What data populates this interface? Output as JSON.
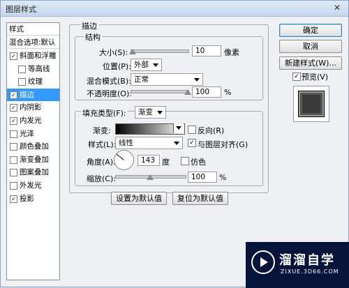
{
  "window": {
    "title": "图层样式",
    "close_glyph": "✕"
  },
  "styles_panel": {
    "header": "样式",
    "blend_options": "混合选项:默认",
    "items": [
      {
        "label": "斜面和浮雕",
        "checked": true,
        "sub": false
      },
      {
        "label": "等高线",
        "checked": false,
        "sub": true
      },
      {
        "label": "纹理",
        "checked": false,
        "sub": true
      },
      {
        "label": "描边",
        "checked": true,
        "sub": false,
        "selected": true
      },
      {
        "label": "内阴影",
        "checked": true,
        "sub": false
      },
      {
        "label": "内发光",
        "checked": true,
        "sub": false
      },
      {
        "label": "光泽",
        "checked": false,
        "sub": false
      },
      {
        "label": "颜色叠加",
        "checked": false,
        "sub": false
      },
      {
        "label": "渐变叠加",
        "checked": false,
        "sub": false
      },
      {
        "label": "图案叠加",
        "checked": false,
        "sub": false
      },
      {
        "label": "外发光",
        "checked": false,
        "sub": false
      },
      {
        "label": "投影",
        "checked": true,
        "sub": false
      }
    ]
  },
  "stroke": {
    "title": "描边",
    "structure": {
      "title": "结构",
      "size_label": "大小(S):",
      "size_value": "10",
      "size_unit": "像素",
      "position_label": "位置(P):",
      "position_value": "外部",
      "blend_label": "混合模式(B):",
      "blend_value": "正常",
      "opacity_label": "不透明度(O):",
      "opacity_value": "100",
      "opacity_unit": "%",
      "size_level": 0.04,
      "opacity_level": 1.0
    },
    "fill": {
      "type_label": "填充类型(F):",
      "type_value": "渐变",
      "gradient_label": "渐变:",
      "reverse_label": "反向(R)",
      "reverse_checked": false,
      "style_label": "样式(L):",
      "style_value": "线性",
      "align_label": "与图层对齐(G)",
      "align_checked": true,
      "angle_label": "角度(A):",
      "angle_value": "143",
      "angle_unit": "度",
      "dither_label": "仿色",
      "dither_checked": false,
      "scale_label": "缩放(C):",
      "scale_value": "100",
      "scale_unit": "%",
      "scale_level": 0.5
    },
    "make_default": "设置为默认值",
    "reset_default": "复位为默认值"
  },
  "buttons": {
    "ok": "确定",
    "cancel": "取消",
    "new_style": "新建样式(W)...",
    "preview_label": "预览(V)",
    "preview_checked": true
  },
  "watermark": {
    "line1": "溜溜自学",
    "line2": "ZIXUE.3D66.COM"
  }
}
